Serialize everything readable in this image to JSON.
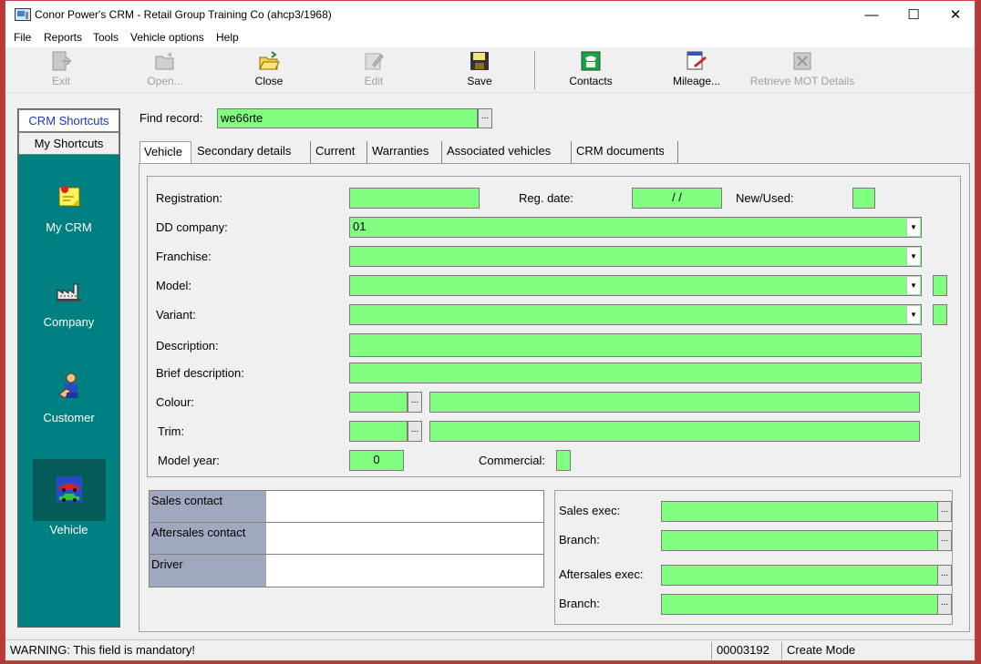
{
  "window": {
    "title": "Conor Power's CRM - Retail Group Training Co (ahcp3/1968)",
    "controls": {
      "minimize": "—",
      "maximize": "☐",
      "close": "✕"
    }
  },
  "menu": [
    "File",
    "Reports",
    "Tools",
    "Vehicle options",
    "Help"
  ],
  "toolbar": [
    {
      "label": "Exit",
      "icon": "exit-icon",
      "enabled": false
    },
    {
      "label": "Open...",
      "icon": "open-icon",
      "enabled": false
    },
    {
      "label": "Close",
      "icon": "folder-icon",
      "enabled": true
    },
    {
      "label": "Edit",
      "icon": "edit-icon",
      "enabled": false
    },
    {
      "label": "Save",
      "icon": "save-icon",
      "enabled": true
    },
    {
      "label": "Contacts",
      "icon": "phone-icon",
      "enabled": true
    },
    {
      "label": "Mileage...",
      "icon": "mileage-icon",
      "enabled": true
    },
    {
      "label": "Retrieve MOT Details",
      "icon": "mot-icon",
      "enabled": false
    }
  ],
  "shortcuts": {
    "tabs": {
      "active": "CRM Shortcuts",
      "inactive": "My Shortcuts"
    },
    "items": [
      {
        "label": "My CRM",
        "icon": "sticky-note-icon"
      },
      {
        "label": "Company",
        "icon": "factory-icon"
      },
      {
        "label": "Customer",
        "icon": "person-icon"
      },
      {
        "label": "Vehicle",
        "icon": "cars-icon",
        "selected": true
      }
    ]
  },
  "find": {
    "label": "Find record:",
    "value": "we66rte",
    "button": "..."
  },
  "tabs": [
    "Vehicle",
    "Secondary details",
    "Current",
    "Warranties",
    "Associated vehicles",
    "CRM documents"
  ],
  "vehicle": {
    "registration_label": "Registration:",
    "registration_value": "",
    "reg_date_label": "Reg. date:",
    "reg_date_value": "/   /",
    "new_used_label": "New/Used:",
    "dd_company_label": "DD company:",
    "dd_company_value": "01",
    "franchise_label": "Franchise:",
    "model_label": "Model:",
    "variant_label": "Variant:",
    "description_label": "Description:",
    "brief_description_label": "Brief description:",
    "colour_label": "Colour:",
    "trim_label": "Trim:",
    "model_year_label": "Model year:",
    "model_year_value": "0",
    "commercial_label": "Commercial:",
    "ellipsis": "...",
    "dropdown_arrow": "▼"
  },
  "contacts": {
    "rows": [
      "Sales contact",
      "Aftersales contact",
      "Driver"
    ]
  },
  "exec": {
    "sales_exec_label": "Sales exec:",
    "branch_label": "Branch:",
    "aftersales_exec_label": "Aftersales exec:",
    "branch2_label": "Branch:"
  },
  "status": {
    "message": "WARNING: This field is mandatory!",
    "record_id": "00003192",
    "mode": "Create Mode"
  },
  "colors": {
    "field_green": "#80ff80",
    "shortcut_teal": "#008080",
    "header_gray": "#a0a8c0"
  }
}
